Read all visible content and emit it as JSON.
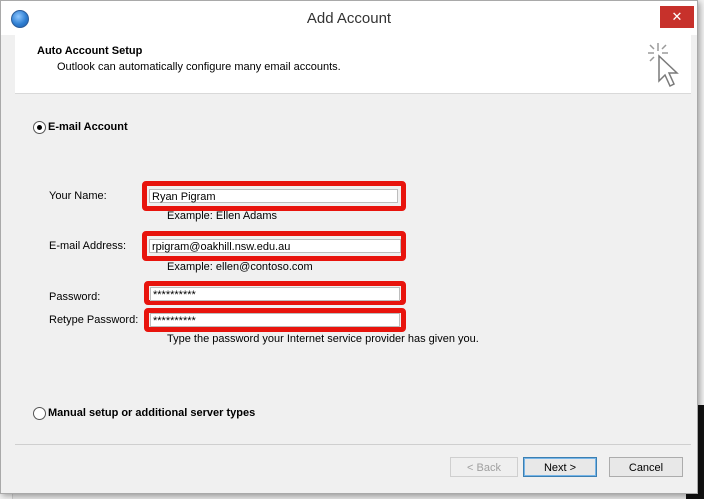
{
  "window": {
    "title": "Add Account",
    "close_label": "✕"
  },
  "header": {
    "title": "Auto Account Setup",
    "subtitle": "Outlook can automatically configure many email accounts."
  },
  "options": {
    "email_account_label": "E-mail Account",
    "email_account_selected": true,
    "manual_setup_label": "Manual setup or additional server types",
    "manual_setup_selected": false
  },
  "form": {
    "your_name_label": "Your Name:",
    "your_name_value": "Ryan Pigram",
    "your_name_example": "Example: Ellen Adams",
    "email_label": "E-mail Address:",
    "email_value": "rpigram@oakhill.nsw.edu.au",
    "email_example": "Example: ellen@contoso.com",
    "password_label": "Password:",
    "password_value": "**********",
    "retype_label": "Retype Password:",
    "retype_value": "**********",
    "password_hint": "Type the password your Internet service provider has given you."
  },
  "buttons": {
    "back": "< Back",
    "next": "Next >",
    "cancel": "Cancel"
  },
  "colors": {
    "highlight": "#e8140d",
    "close": "#c7312b"
  },
  "icons": {
    "app": "outlook-globe-icon",
    "wizard": "cursor-sparkle-icon"
  }
}
